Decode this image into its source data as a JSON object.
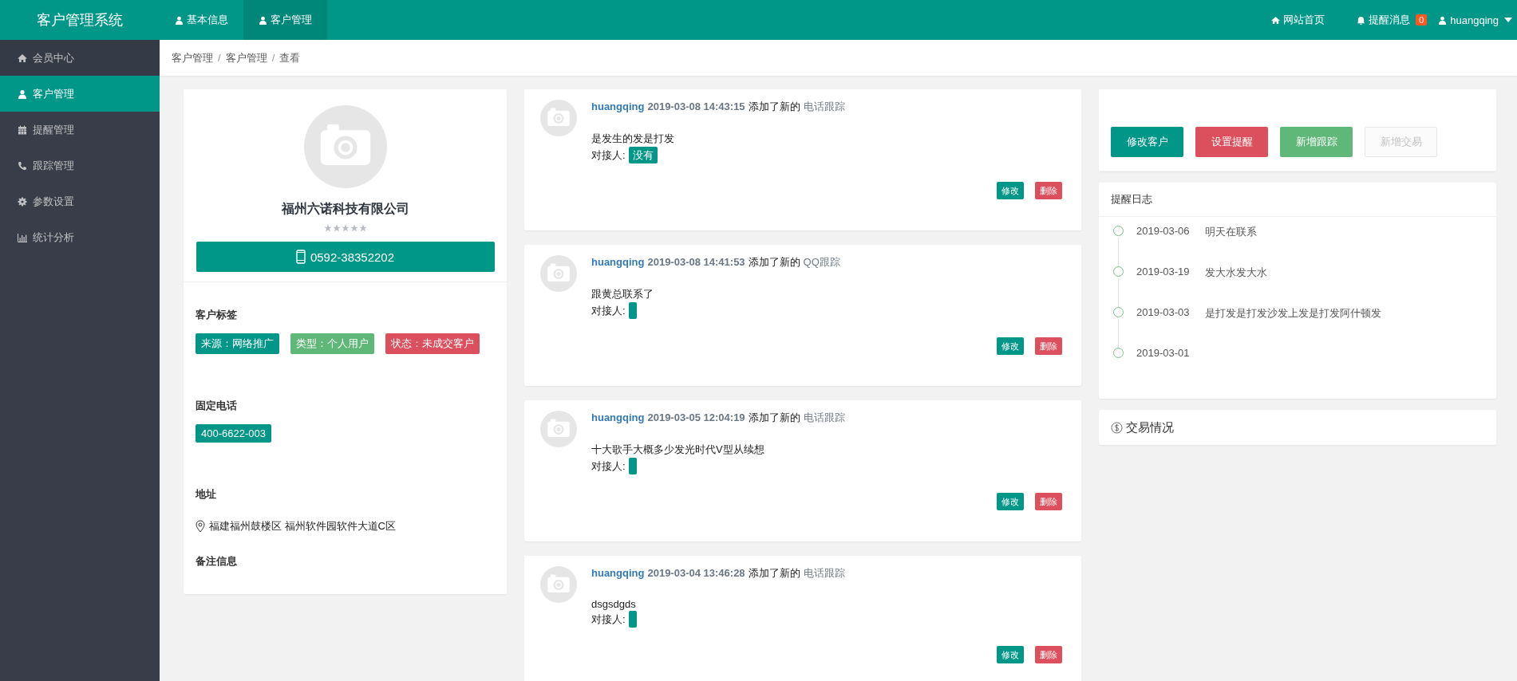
{
  "app": {
    "title": "客户管理系统"
  },
  "top_nav": [
    {
      "label": "基本信息",
      "selected": false
    },
    {
      "label": "客户管理",
      "selected": true
    }
  ],
  "top_right": {
    "home": "网站首页",
    "messages": "提醒消息",
    "message_count": "0",
    "user": "huangqing"
  },
  "sidebar": {
    "header": "会员中心",
    "items": [
      {
        "label": "客户管理",
        "selected": true
      },
      {
        "label": "提醒管理",
        "selected": false
      },
      {
        "label": "跟踪管理",
        "selected": false
      },
      {
        "label": "参数设置",
        "selected": false
      },
      {
        "label": "统计分析",
        "selected": false
      }
    ]
  },
  "breadcrumb": {
    "separator": "/",
    "items": [
      "客户管理",
      "客户管理",
      "查看"
    ]
  },
  "customer": {
    "name": "福州六诺科技有限公司",
    "stars": 0,
    "mobile": "0592-38352202",
    "tags_title": "客户标签",
    "tags": [
      {
        "label": "来源：网络推广",
        "color": "#009688"
      },
      {
        "label": "类型：个人用户",
        "color": "#5fb878"
      },
      {
        "label": "状态：未成交客户",
        "color": "#dc505e"
      }
    ],
    "phone_title": "固定电话",
    "phone": "400-6622-003",
    "address_title": "地址",
    "address": "福建福州鼓楼区 福州软件园软件大道C区",
    "notes_title": "备注信息"
  },
  "tracking": [
    {
      "user": "huangqing",
      "time": "2019-03-08 14:43:15",
      "action": "添加了新的",
      "type": "电话跟踪",
      "content": "是发生的发是打发",
      "contact_label": "对接人:",
      "contact": "没有",
      "edit": "修改",
      "delete": "删除"
    },
    {
      "user": "huangqing",
      "time": "2019-03-08 14:41:53",
      "action": "添加了新的",
      "type": "QQ跟踪",
      "content": "跟黄总联系了",
      "contact_label": "对接人:",
      "edit": "修改",
      "delete": "删除"
    },
    {
      "user": "huangqing",
      "time": "2019-03-05 12:04:19",
      "action": "添加了新的",
      "type": "电话跟踪",
      "content": "十大歌手大概多少发光时代V型从续想",
      "contact_label": "对接人:",
      "edit": "修改",
      "delete": "删除"
    },
    {
      "user": "huangqing",
      "time": "2019-03-04 13:46:28",
      "action": "添加了新的",
      "type": "电话跟踪",
      "content": "dsgsdgds",
      "contact_label": "对接人:",
      "edit": "修改",
      "delete": "删除"
    }
  ],
  "actions": [
    {
      "label": "修改客户",
      "color": "#009688",
      "disabled": false
    },
    {
      "label": "设置提醒",
      "color": "#dc505e",
      "disabled": false
    },
    {
      "label": "新增跟踪",
      "color": "#5fb878",
      "disabled": false
    },
    {
      "label": "新增交易",
      "color": "#fbfbfb",
      "disabled": true
    }
  ],
  "reminder_log": {
    "title": "提醒日志",
    "entries": [
      {
        "date": "2019-03-06",
        "text": "明天在联系"
      },
      {
        "date": "2019-03-19",
        "text": "发大水发大水"
      },
      {
        "date": "2019-03-03",
        "text": "是打发是打发沙发上发是打发阿什顿发"
      },
      {
        "date": "2019-03-01"
      }
    ]
  },
  "trade": {
    "title": "交易情况"
  }
}
